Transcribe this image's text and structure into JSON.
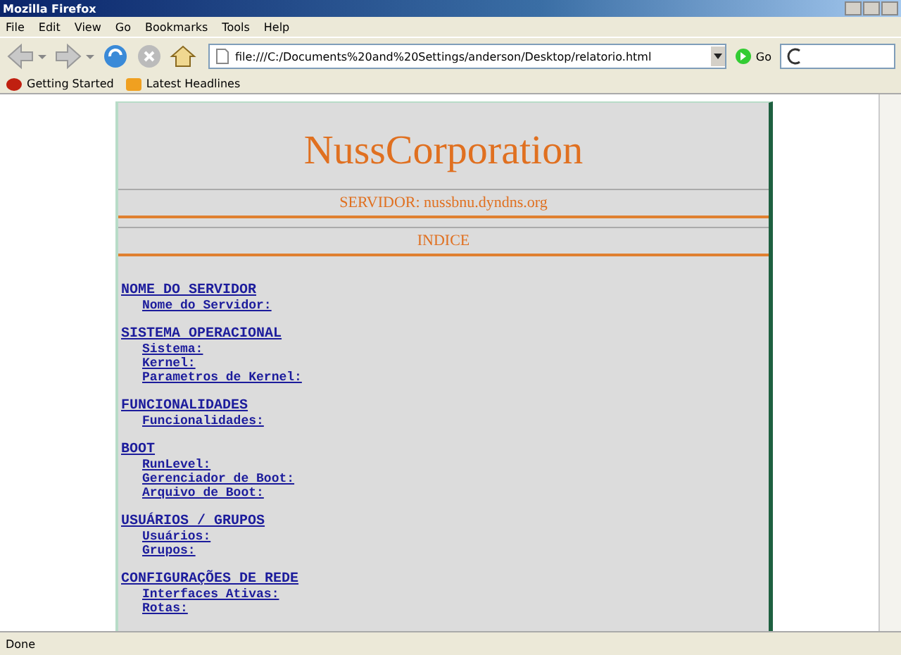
{
  "window": {
    "title": "Mozilla Firefox"
  },
  "menu": [
    "File",
    "Edit",
    "View",
    "Go",
    "Bookmarks",
    "Tools",
    "Help"
  ],
  "address": {
    "value": "file:///C:/Documents%20and%20Settings/anderson/Desktop/relatorio.html"
  },
  "go_label": "Go",
  "bookmarks": [
    {
      "label": "Getting Started",
      "kind": "start"
    },
    {
      "label": "Latest Headlines",
      "kind": "feed"
    }
  ],
  "page": {
    "title": "NussCorporation",
    "server": "SERVIDOR: nussbnu.dyndns.org",
    "index_heading": "INDICE",
    "sections": [
      {
        "title": "NOME DO SERVIDOR",
        "items": [
          "Nome do Servidor:"
        ]
      },
      {
        "title": "SISTEMA OPERACIONAL",
        "items": [
          "Sistema:",
          "Kernel:",
          "Parametros de Kernel:"
        ]
      },
      {
        "title": "FUNCIONALIDADES",
        "items": [
          "Funcionalidades:"
        ]
      },
      {
        "title": "BOOT",
        "items": [
          "RunLevel:",
          "Gerenciador de Boot:",
          "Arquivo de Boot:"
        ]
      },
      {
        "title": "USUÁRIOS / GRUPOS",
        "items": [
          "Usuários:",
          "Grupos:"
        ]
      },
      {
        "title": "CONFIGURAÇÕES DE REDE",
        "items": [
          "Interfaces Ativas:",
          "Rotas:"
        ]
      }
    ]
  },
  "status_bar": "Done"
}
